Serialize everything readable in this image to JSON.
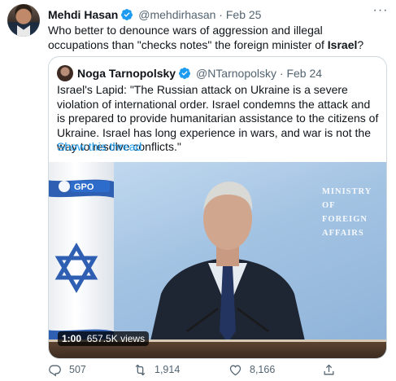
{
  "tweet": {
    "author_name": "Mehdi Hasan",
    "handle": "@mehdirhasan",
    "separator": "·",
    "date": "Feb 25",
    "more_label": "···",
    "text_before": "Who better to denounce wars of aggression and illegal occupations than \"checks notes\" the foreign minister of ",
    "text_bold": "Israel",
    "text_after": "?"
  },
  "quoted": {
    "author_name": "Noga Tarnopolsky",
    "handle": "@NTarnopolsky",
    "separator": "·",
    "date": "Feb 24",
    "text": "Israel's Lapid: \"The Russian attack on Ukraine is a severe violation of international order. Israel condemns the attack and is prepared to provide humanitarian assistance to the citizens of Ukraine. Israel has long experience in wars, and war is not the way to resolve conflicts.\"",
    "show_thread": "Show this thread",
    "video": {
      "wall_text_lines": [
        "MINISTRY",
        "OF FOREIGN",
        "AFFAIRS"
      ],
      "logo_text": "GPO",
      "time": "1:00",
      "views": "657.5K views"
    }
  },
  "actions": {
    "reply_count": "507",
    "retweet_count": "1,914",
    "like_count": "8,166"
  },
  "colors": {
    "accent": "#1d9bf0",
    "muted": "#536471",
    "border": "#cfd9de"
  },
  "icons": [
    "verified-badge-icon",
    "more-icon",
    "reply-icon",
    "retweet-icon",
    "like-icon",
    "share-icon"
  ]
}
